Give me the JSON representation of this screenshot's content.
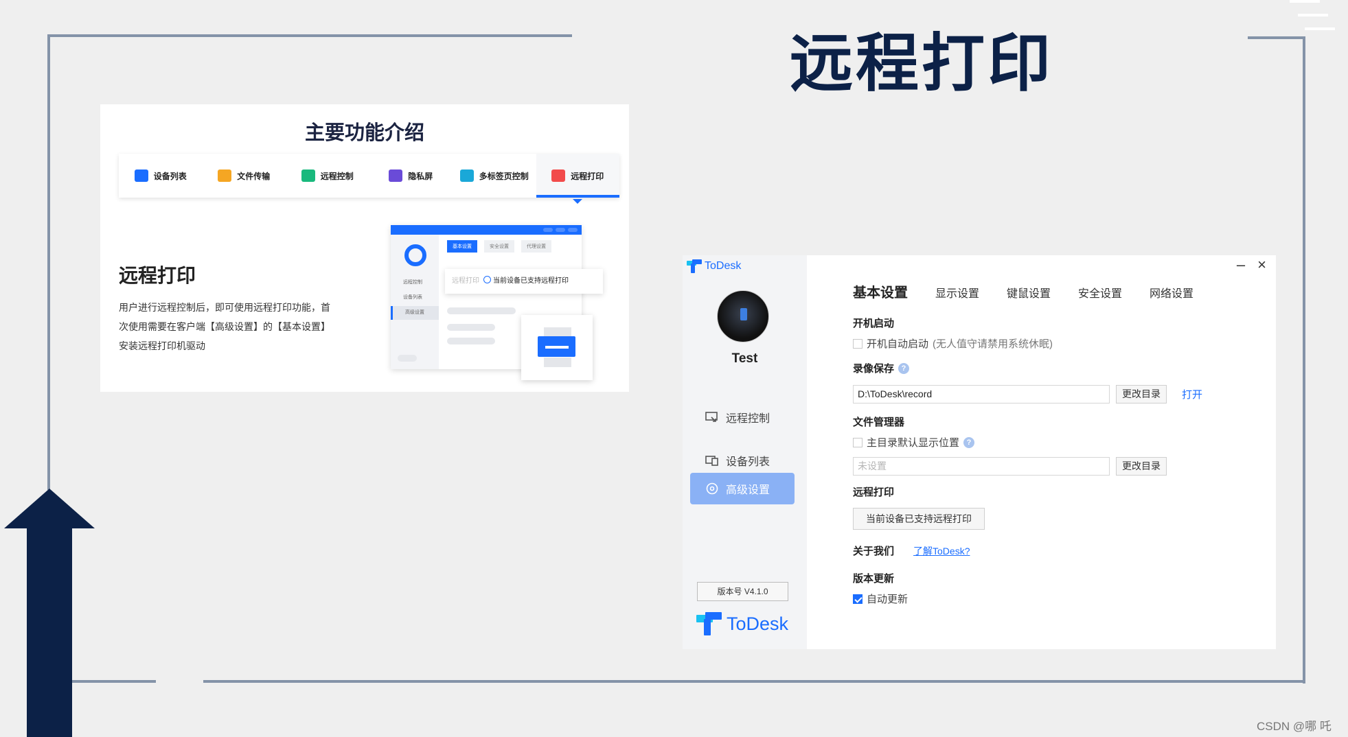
{
  "slide": {
    "title": "远程打印",
    "watermark": "CSDN @哪 吒"
  },
  "intro": {
    "heading": "主要功能介绍",
    "tabs": [
      {
        "label": "设备列表",
        "icon": "device-list-icon",
        "color": "#1a6dff"
      },
      {
        "label": "文件传输",
        "icon": "folder-icon",
        "color": "#f5a623"
      },
      {
        "label": "远程控制",
        "icon": "remote-control-icon",
        "color": "#19b97d"
      },
      {
        "label": "隐私屏",
        "icon": "privacy-screen-icon",
        "color": "#6a4bd8"
      },
      {
        "label": "多标签页控制",
        "icon": "multi-tab-icon",
        "color": "#1aa8d8"
      },
      {
        "label": "远程打印",
        "icon": "printer-icon",
        "color": "#f24b4b"
      }
    ],
    "active_tab": "远程打印",
    "subtitle": "远程打印",
    "description": "用户进行远程控制后，即可使用远程打印功能，首次使用需要在客户端【高级设置】的【基本设置】安装远程打印机驱动",
    "mockup": {
      "side_items": [
        "远程控制",
        "设备列表",
        "高级设置"
      ],
      "tabs": [
        "基本设置",
        "安全设置",
        "代理设置"
      ],
      "float_muted": "远程打印",
      "float_text": "当前设备已支持远程打印"
    }
  },
  "todesk": {
    "logo_text": "ToDesk",
    "username": "Test",
    "nav": [
      {
        "label": "远程控制",
        "icon": "monitor-remote-icon"
      },
      {
        "label": "设备列表",
        "icon": "devices-icon"
      },
      {
        "label": "高级设置",
        "icon": "settings-icon"
      }
    ],
    "version": "版本号 V4.1.0",
    "controls": {
      "minimize": "–",
      "close": "×"
    },
    "tabs": [
      "基本设置",
      "显示设置",
      "键鼠设置",
      "安全设置",
      "网络设置"
    ],
    "startup": {
      "section": "开机启动",
      "checkbox_label": "开机自动启动",
      "hint": "(无人值守请禁用系统休眠)",
      "checked": false
    },
    "recording": {
      "section": "录像保存",
      "path": "D:\\ToDesk\\record",
      "change_dir": "更改目录",
      "open": "打开"
    },
    "file_manager": {
      "section": "文件管理器",
      "checkbox_label": "主目录默认显示位置",
      "checked": false,
      "placeholder": "未设置",
      "change_dir": "更改目录"
    },
    "remote_print": {
      "section": "远程打印",
      "status_button": "当前设备已支持远程打印"
    },
    "about": {
      "section": "关于我们",
      "link": "了解ToDesk?"
    },
    "update": {
      "section": "版本更新",
      "checkbox_label": "自动更新",
      "checked": true
    },
    "accent_color": "#1a6dff"
  }
}
